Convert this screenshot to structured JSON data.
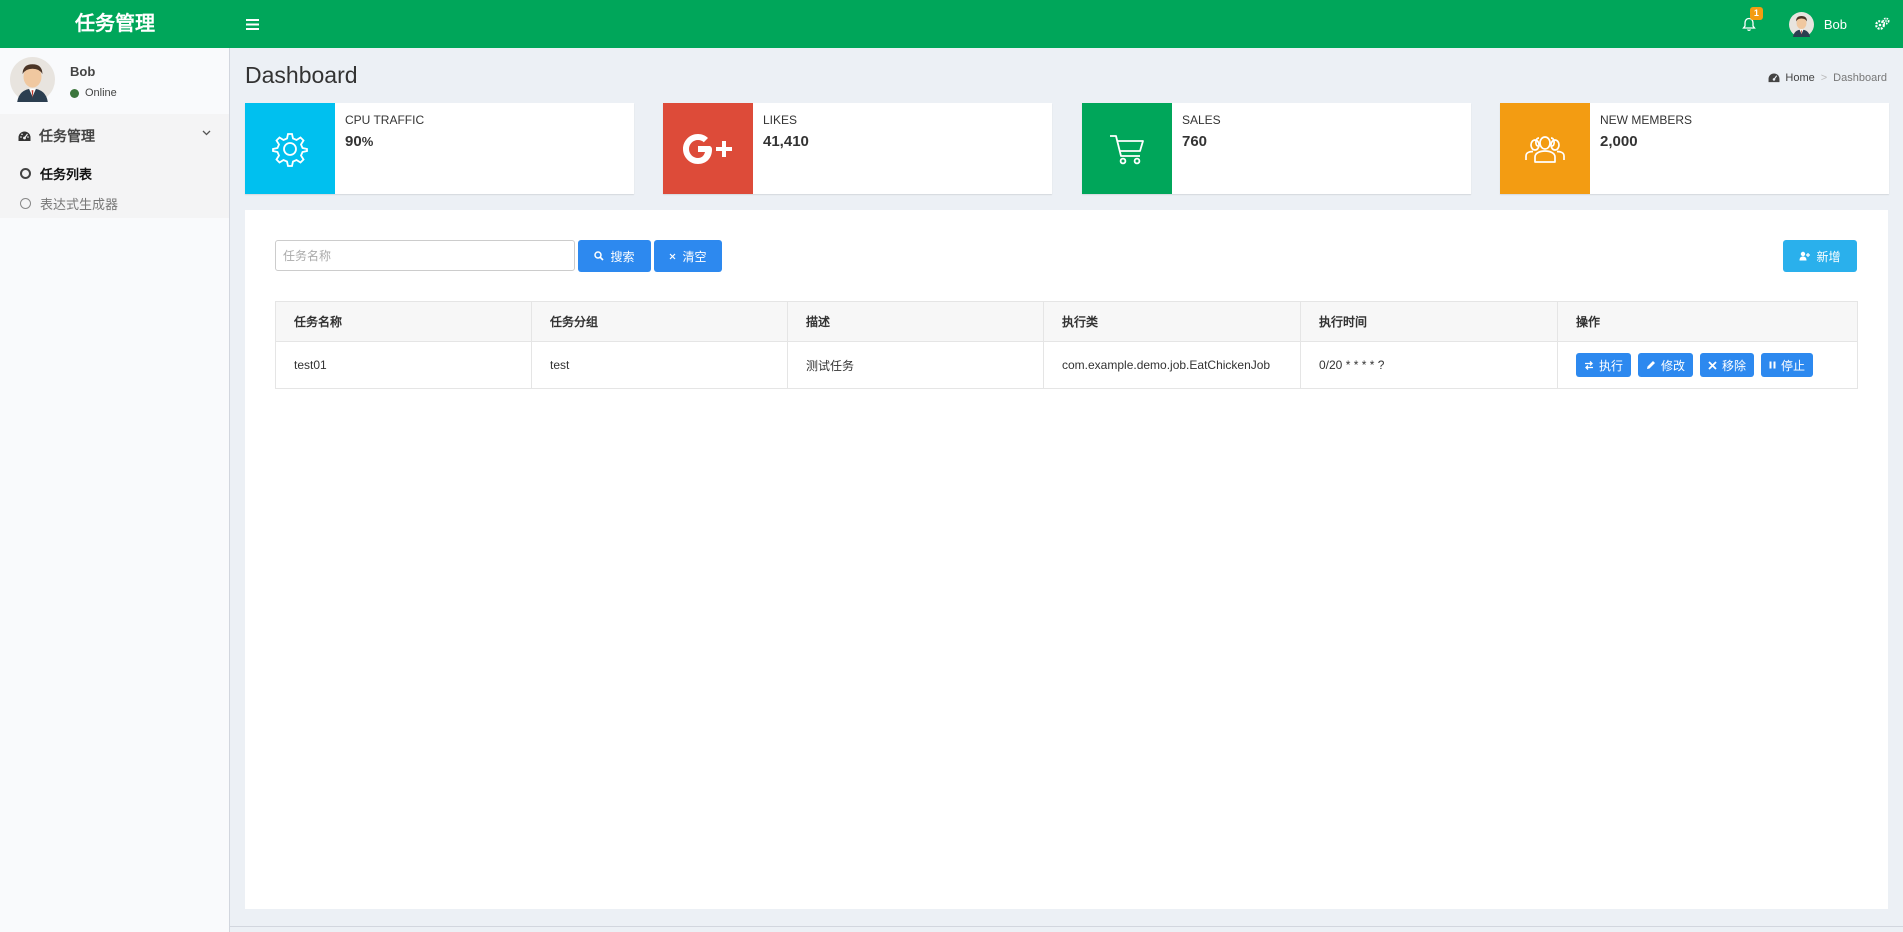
{
  "header": {
    "logo": "任务管理",
    "notifications_count": "1",
    "user_name": "Bob"
  },
  "sidebar": {
    "user": {
      "name": "Bob",
      "status": "Online"
    },
    "menu_title": "任务管理",
    "items": [
      {
        "label": "任务列表",
        "active": true
      },
      {
        "label": "表达式生成器",
        "active": false
      }
    ]
  },
  "content": {
    "title": "Dashboard",
    "breadcrumb": {
      "home": "Home",
      "current": "Dashboard"
    }
  },
  "info_boxes": [
    {
      "label": "CPU TRAFFIC",
      "value": "90",
      "unit": "%",
      "color": "#00c0ef",
      "icon": "gear-icon"
    },
    {
      "label": "LIKES",
      "value": "41,410",
      "color": "#dd4b39",
      "icon": "google-plus-icon"
    },
    {
      "label": "SALES",
      "value": "760",
      "color": "#00a65a",
      "icon": "shopping-cart-icon"
    },
    {
      "label": "NEW MEMBERS",
      "value": "2,000",
      "color": "#f39c12",
      "icon": "users-icon"
    }
  ],
  "toolbar": {
    "search_placeholder": "任务名称",
    "search_label": "搜索",
    "clear_label": "清空",
    "add_label": "新增"
  },
  "table": {
    "headers": [
      "任务名称",
      "任务分组",
      "描述",
      "执行类",
      "执行时间",
      "操作"
    ],
    "rows": [
      {
        "name": "test01",
        "group": "test",
        "desc": "测试任务",
        "class": "com.example.demo.job.EatChickenJob",
        "cron": "0/20 * * * * ?"
      }
    ],
    "actions": [
      "执行",
      "修改",
      "移除",
      "停止"
    ]
  },
  "colors": {
    "header": "#00a65a",
    "button_primary": "#2d89ef",
    "button_add": "#2ab0ec"
  }
}
